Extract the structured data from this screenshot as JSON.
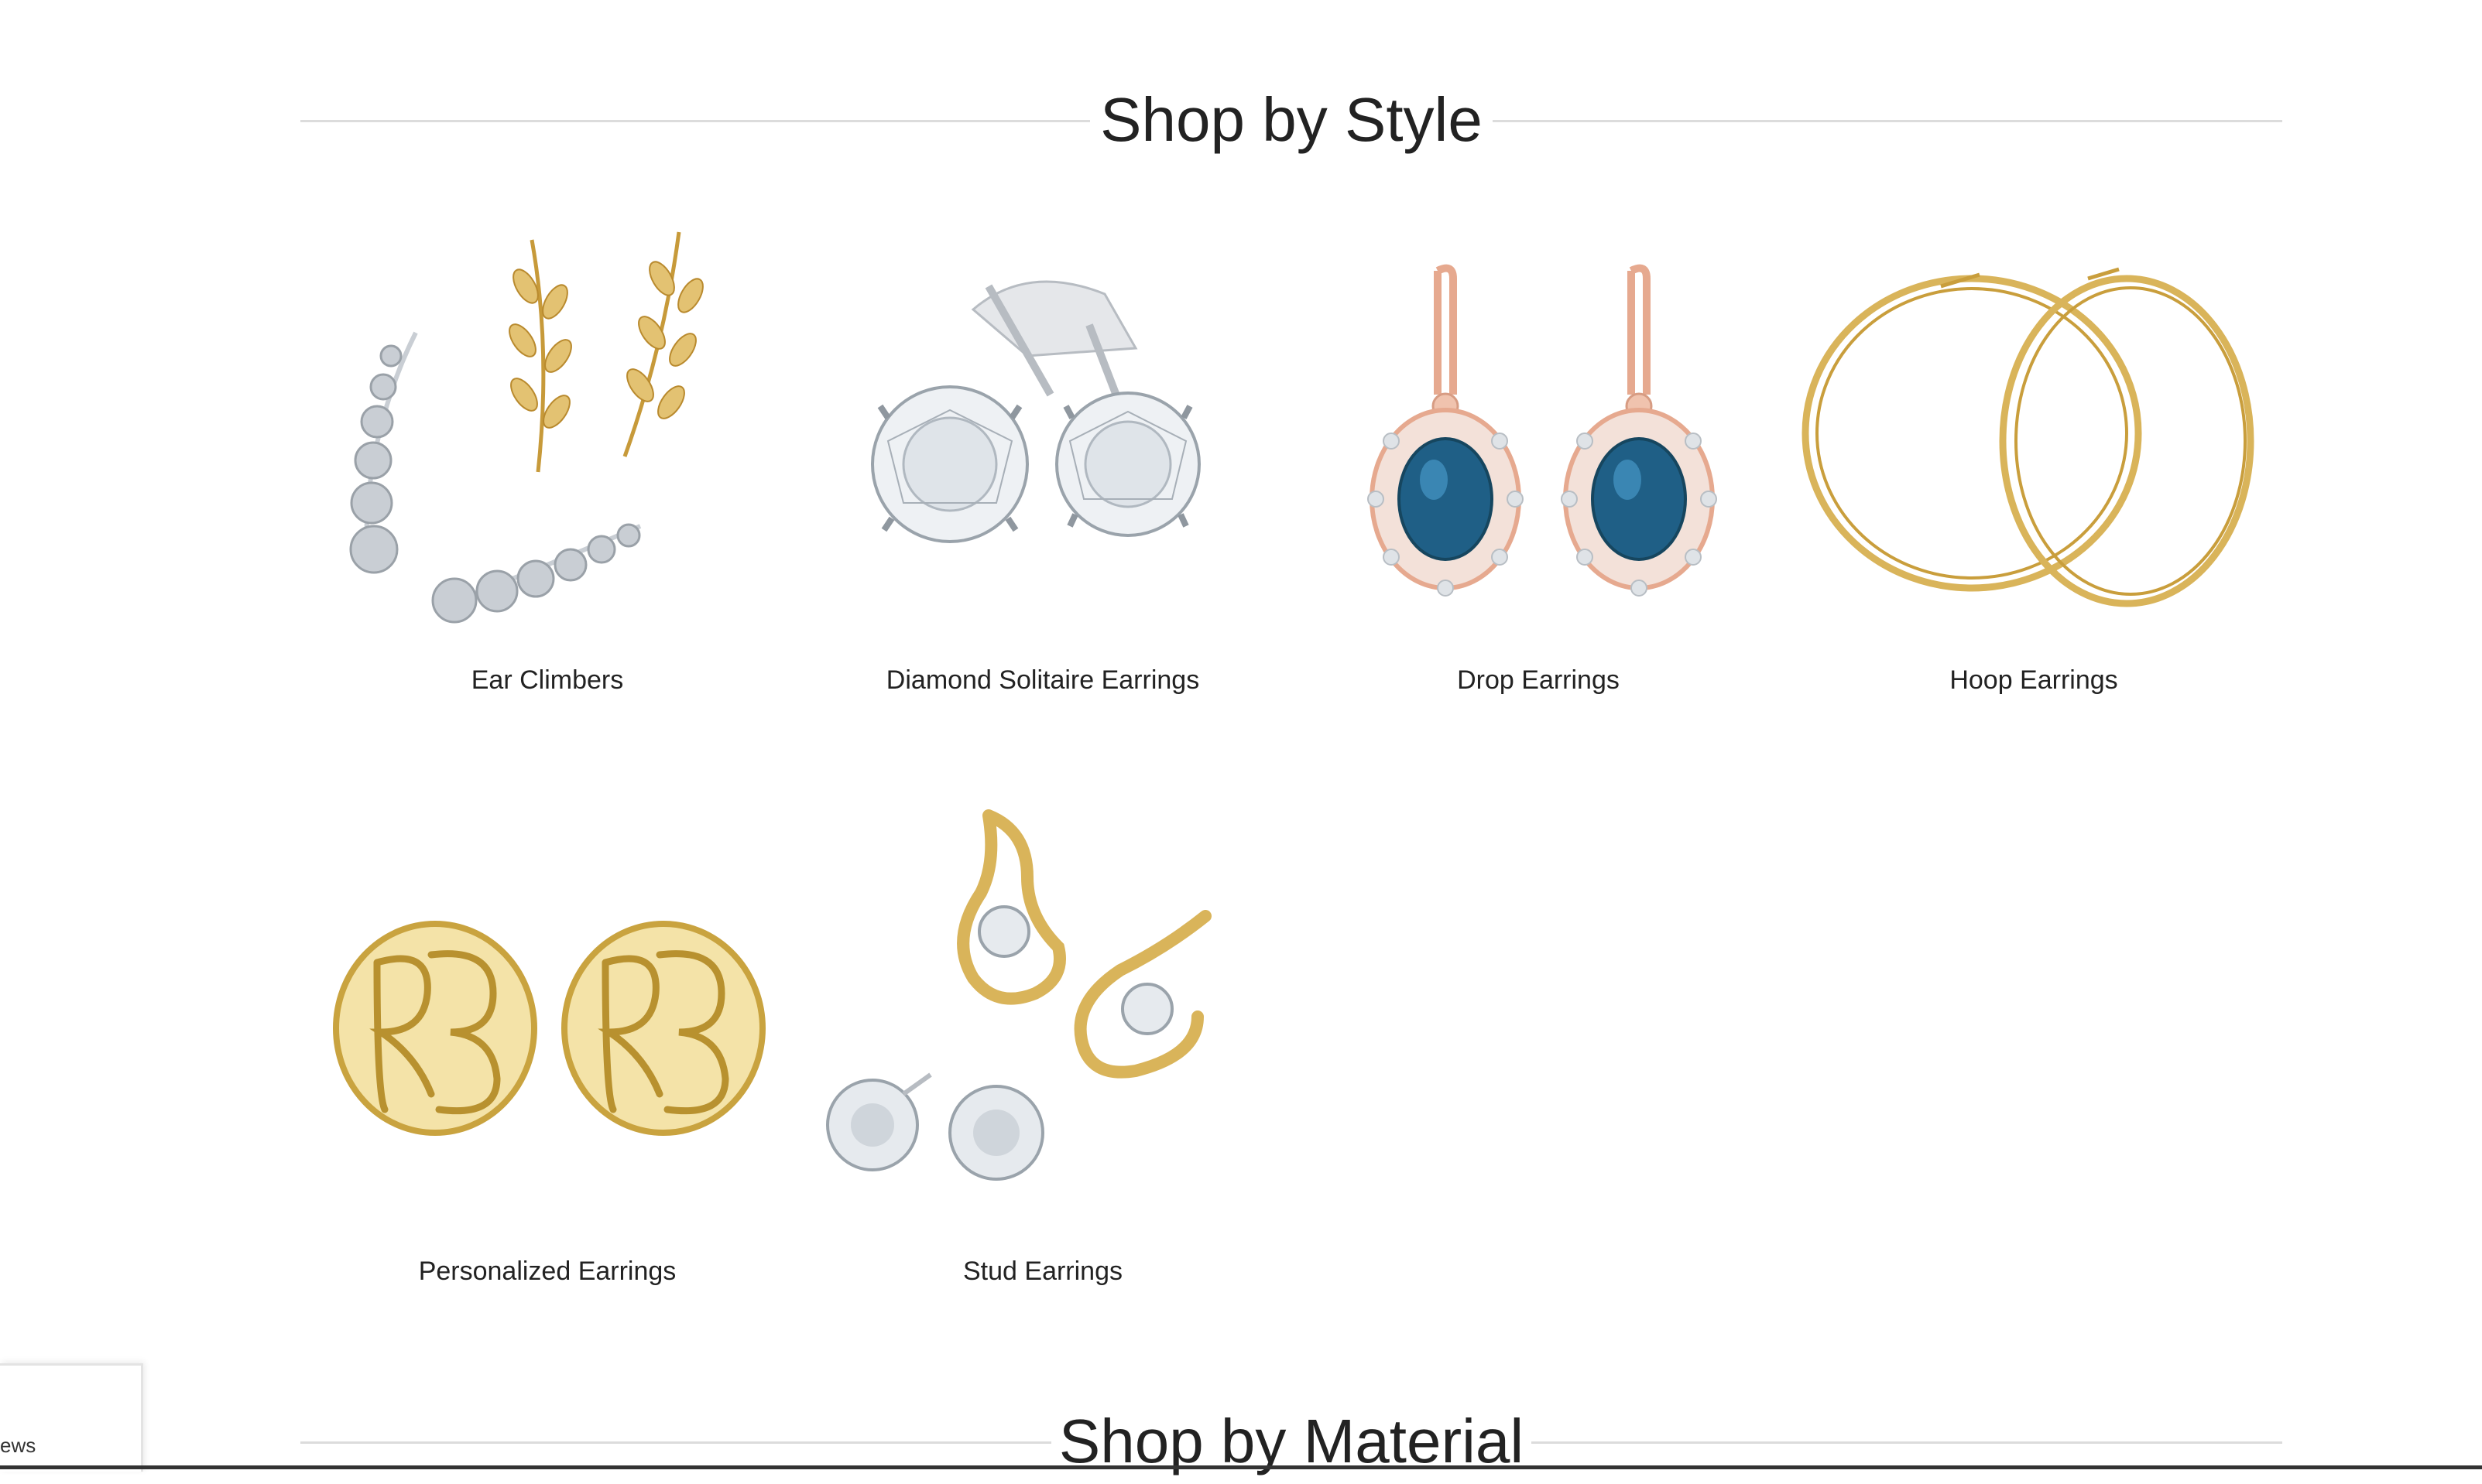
{
  "sections": {
    "style_heading": "Shop by Style",
    "material_heading": "Shop by Material"
  },
  "tiles": [
    {
      "label": "Ear Climbers",
      "icon": "ear-climbers-image"
    },
    {
      "label": "Diamond Solitaire Earrings",
      "icon": "diamond-solitaire-earrings-image"
    },
    {
      "label": "Drop Earrings",
      "icon": "drop-earrings-image"
    },
    {
      "label": "Hoop Earrings",
      "icon": "hoop-earrings-image"
    },
    {
      "label": "Personalized Earrings",
      "icon": "personalized-earrings-image"
    },
    {
      "label": "Stud Earrings",
      "icon": "stud-earrings-image"
    }
  ],
  "reviews_widget": {
    "text": "ews"
  },
  "colors": {
    "gold": "#d9b45a",
    "silver": "#c9ced4",
    "rose_gold": "#e6a98f",
    "sapphire": "#1f5f86",
    "rule": "#dcdcdc"
  }
}
